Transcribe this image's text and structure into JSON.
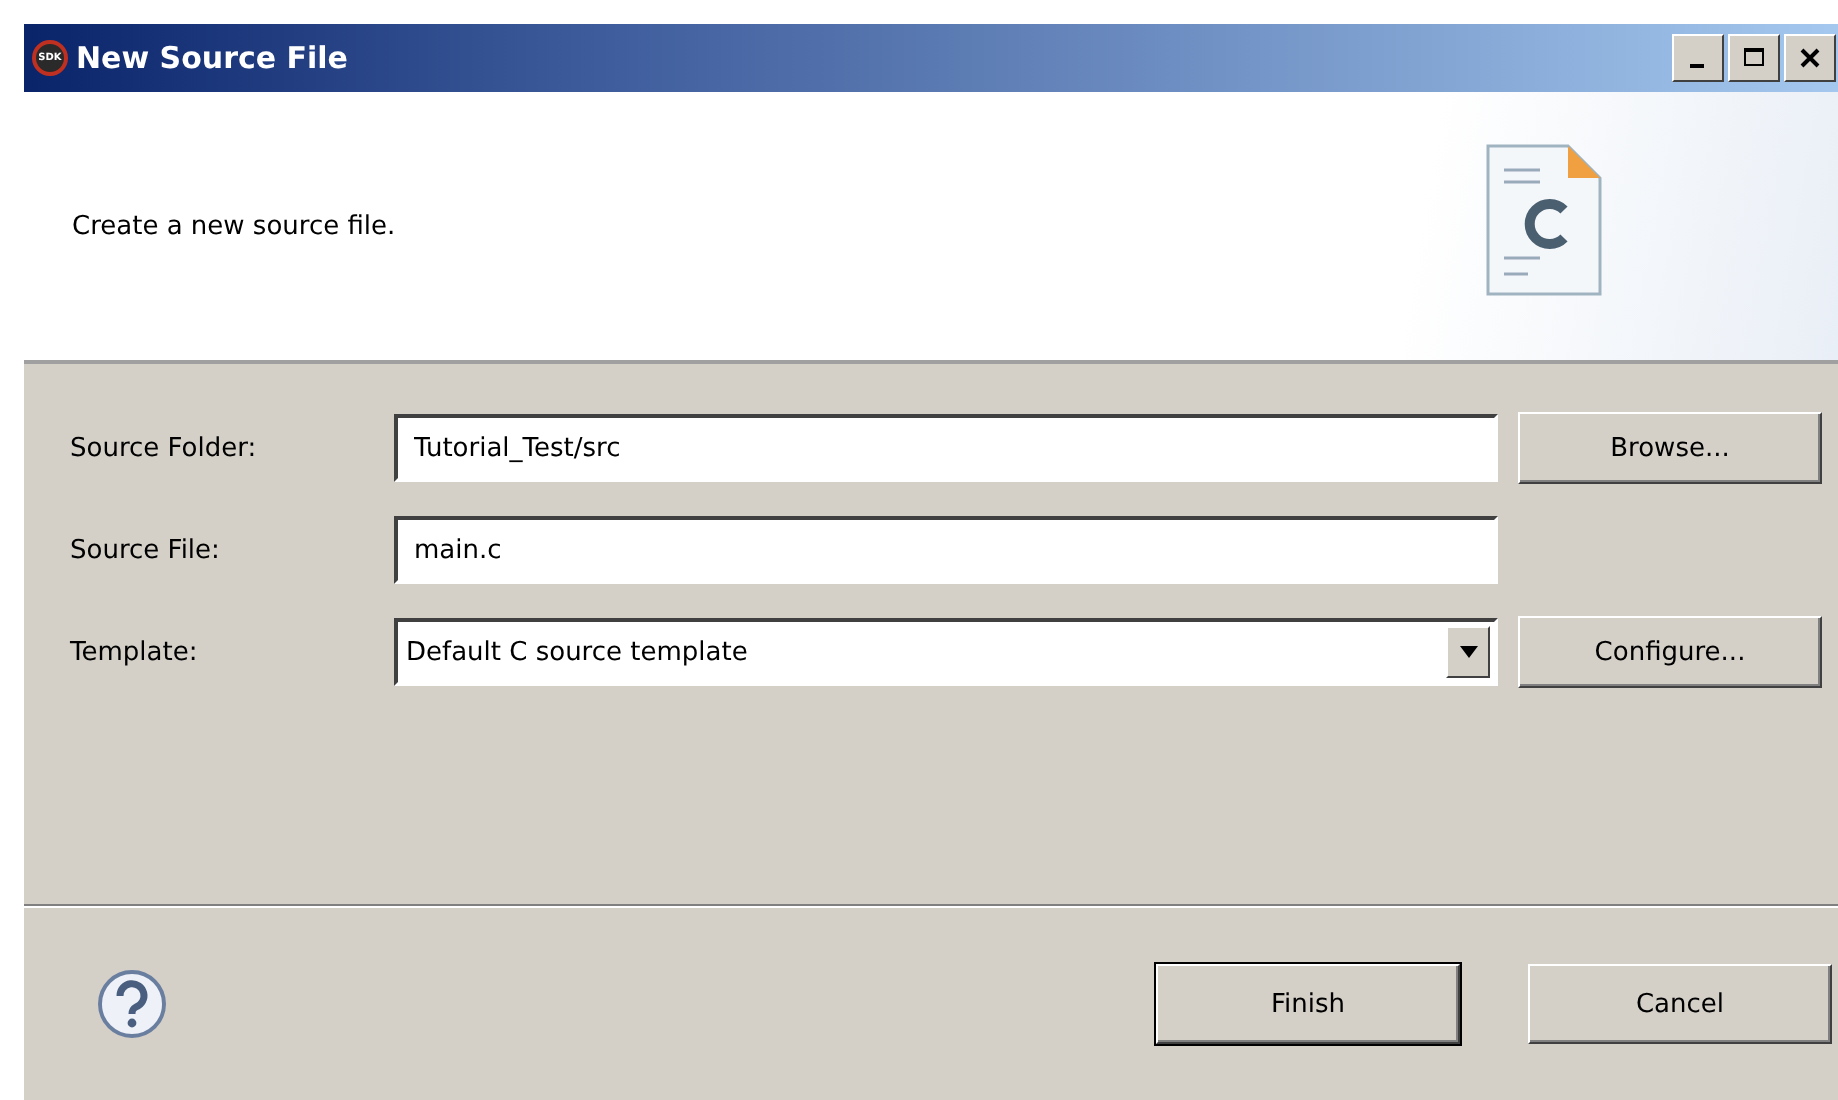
{
  "window": {
    "title": "New Source File",
    "logo": "SDK"
  },
  "header": {
    "message": "Create a new source file."
  },
  "fields": [
    {
      "kind": "text",
      "label": "Source Folder:",
      "value": "Tutorial_Test/src",
      "button": "Browse..."
    },
    {
      "kind": "text",
      "label": "Source File:",
      "value": "main.c"
    },
    {
      "kind": "combo",
      "label": "Template:",
      "value": "Default C source template",
      "button": "Configure..."
    }
  ],
  "buttons": [
    {
      "label": "Finish",
      "default": true
    },
    {
      "label": "Cancel",
      "default": false
    }
  ]
}
